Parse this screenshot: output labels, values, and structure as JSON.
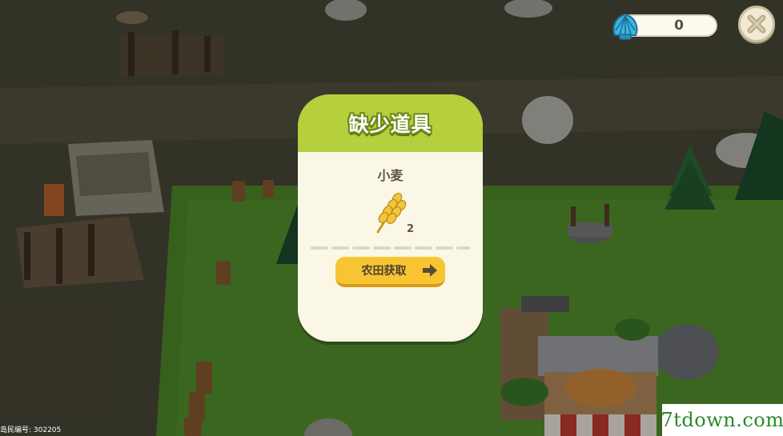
{
  "hud": {
    "currency_icon": "seashell-icon",
    "currency_value": "0",
    "close_icon": "close-icon"
  },
  "dialog": {
    "title": "缺少道具",
    "item_name": "小麦",
    "item_icon": "wheat-icon",
    "item_count": "2",
    "action_label": "农田获取",
    "action_icon": "arrow-right-icon"
  },
  "footer": {
    "island_id": "岛民编号: 302205",
    "watermark": "7tdown.com"
  },
  "colors": {
    "dialog_header": "#b5cf3d",
    "dialog_body": "#fbf7e6",
    "action_button": "#f7c531",
    "currency_shell": "#3fb4e0"
  }
}
